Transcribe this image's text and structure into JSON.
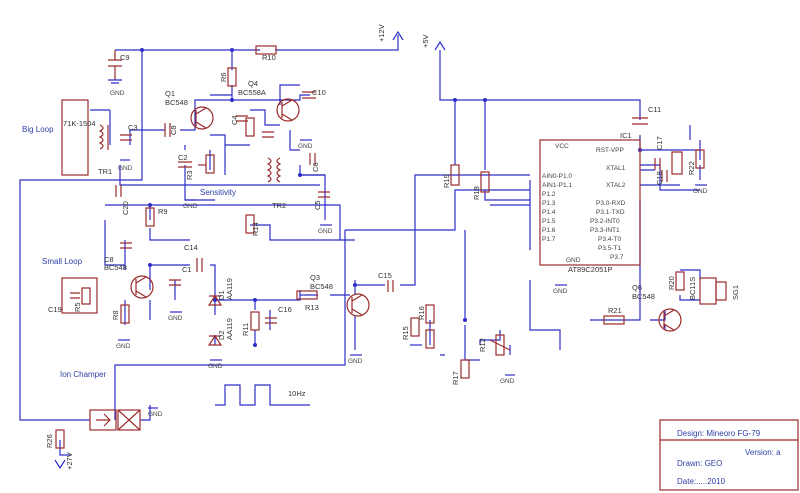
{
  "rails": {
    "v12": "+12V",
    "v5": "+5V",
    "v27": "+27V"
  },
  "labels": {
    "big_loop": "Big Loop",
    "small_loop": "Small Loop",
    "ion_chamber": "Ion Champer",
    "sensitivity": "Sensitivity",
    "freq": "10Hz",
    "coil": "71K-1504",
    "tr1": "TR1",
    "tr2": "TR2"
  },
  "parts": {
    "q1": "Q1",
    "q1_type": "BC548",
    "q4": "Q4",
    "q4_type": "BC558A",
    "q3": "Q3",
    "q3_type": "BC548",
    "q6": "Q6",
    "q6_type": "BC548",
    "q_small": "BC548",
    "ic1": "IC1",
    "ic1_type": "AT89C2051P",
    "sg1": "SG1",
    "sg1_type": "BC11S",
    "d1": "D1",
    "d1_type": "AA119",
    "d2": "D2",
    "d2_type": "AA119",
    "r6": "R6",
    "r7": "R7",
    "r9": "R9",
    "r10": "R10",
    "r11": "R11",
    "r12": "R12",
    "r13": "R13",
    "r14": "R14",
    "r15": "R15",
    "r16": "R16",
    "r17": "R17",
    "r18": "R18",
    "r19": "R19",
    "r20": "R20",
    "r21": "R21",
    "r22": "R22",
    "r26": "R26",
    "r3": "R3",
    "r8": "R8",
    "r5": "R5",
    "c1": "C1",
    "c2": "C2",
    "c3": "C3",
    "c4": "C4",
    "c5": "C5",
    "c6": "C6",
    "c8": "C8",
    "c9": "C9",
    "c10": "C10",
    "c11": "C11",
    "c14": "C14",
    "c15": "C15",
    "c16": "C16",
    "c17": "C17",
    "c18": "C18",
    "c19": "C19",
    "c20": "C20",
    "c28": "C8"
  },
  "gnd": "GND",
  "ic_pins_left": [
    "RST-VPP",
    "XTAL1",
    "XTAL2",
    "P3.0-RXD",
    "P3.1-TXD",
    "P3.2-INT0",
    "P3.3-INT1",
    "P3.4-T0",
    "P3.5-T1",
    "P3.7"
  ],
  "ic_pins_right": [
    "AIN0-P1.0",
    "AIN1-P1.1",
    "P1.2",
    "P1.3",
    "P1.4",
    "P1.5",
    "P1.6",
    "P1.7"
  ],
  "ic_vcc": "VCC",
  "ic_gnd": "GND",
  "title_block": {
    "design": "Design: Mineoro FG-79",
    "version": "Version: a",
    "drawn": "Drawn: GEO",
    "date": "Date:.....2010"
  }
}
